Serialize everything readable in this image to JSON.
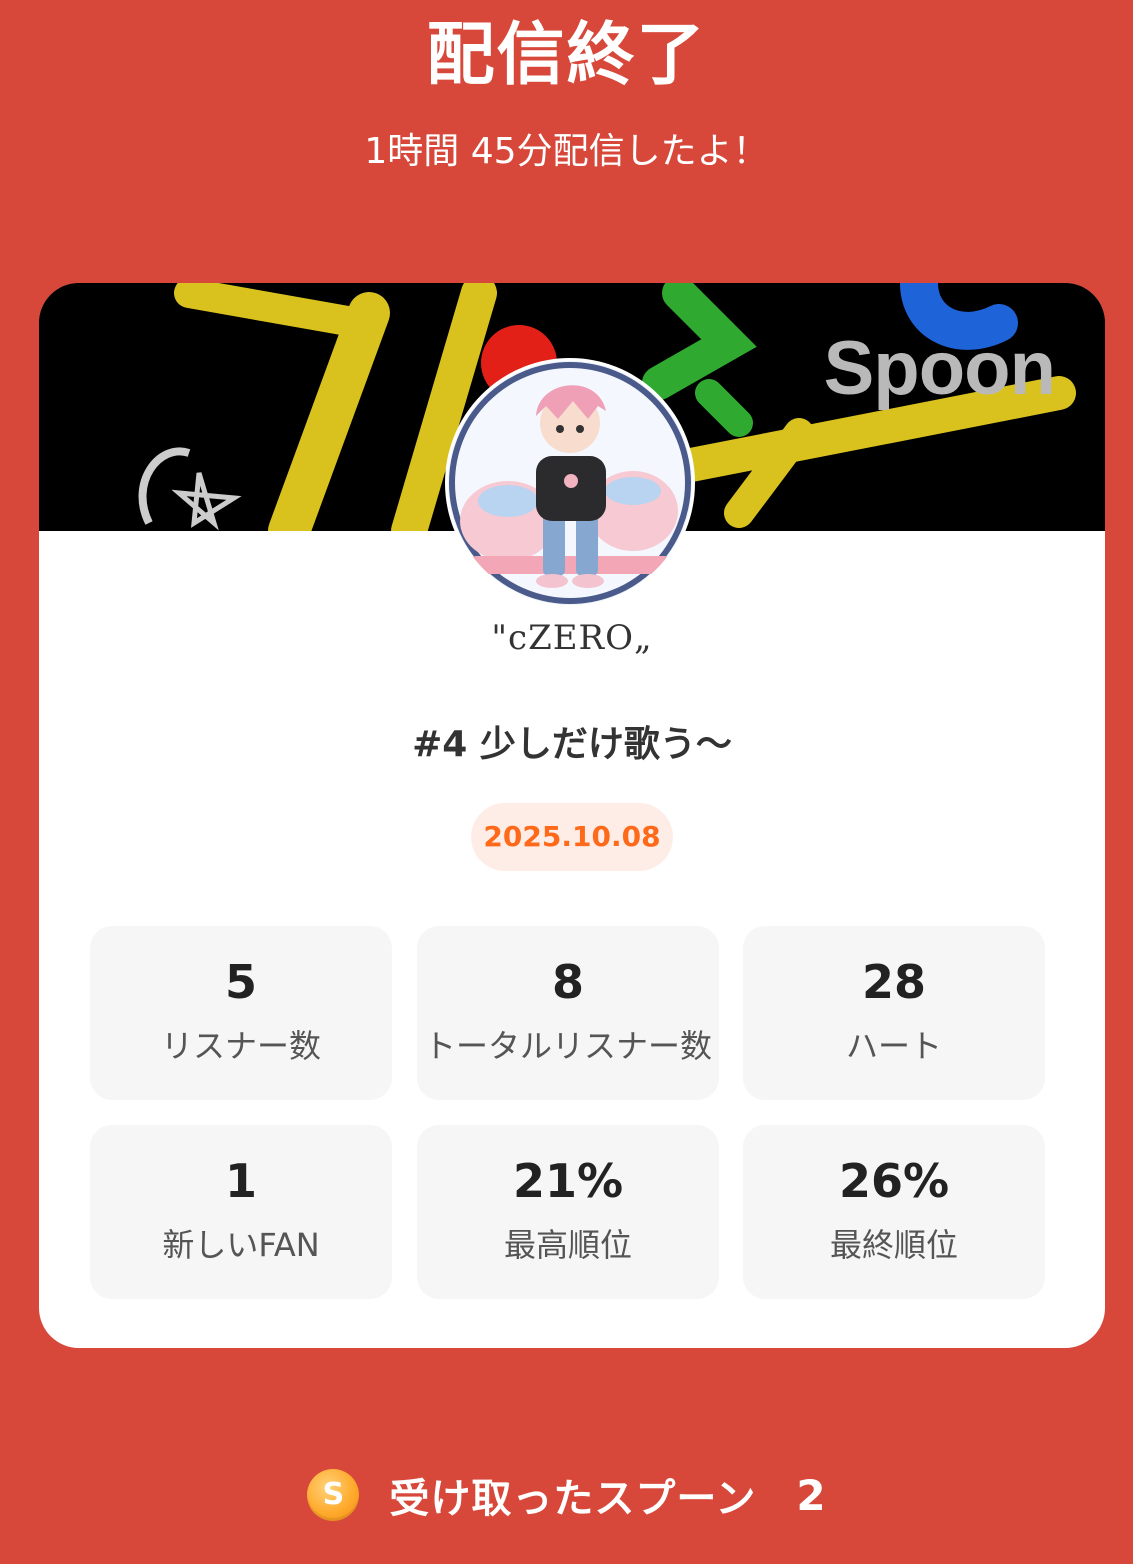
{
  "header": {
    "title": "配信終了",
    "subtitle": "1時間 45分配信したよ！"
  },
  "card": {
    "banner_logo": "Spoon",
    "avatar_icon": "avatar-chibi-character",
    "username": "\"ϲZERO„",
    "live_title": "#4 少しだけ歌う〜",
    "date": "2025.10.08"
  },
  "stats": [
    {
      "value": "5",
      "label": "リスナー数"
    },
    {
      "value": "8",
      "label": "トータルリスナー数"
    },
    {
      "value": "28",
      "label": "ハート"
    },
    {
      "value": "1",
      "label": "新しいFAN"
    },
    {
      "value": "21%",
      "label": "最高順位"
    },
    {
      "value": "26%",
      "label": "最終順位"
    }
  ],
  "footer": {
    "coin_icon": "S",
    "label": "受け取ったスプーン",
    "count": "2"
  },
  "colors": {
    "background": "#d7483a",
    "card": "#ffffff",
    "date_text": "#ff6a1a",
    "date_bg": "#fdede6",
    "stat_bg": "#f6f6f6"
  }
}
